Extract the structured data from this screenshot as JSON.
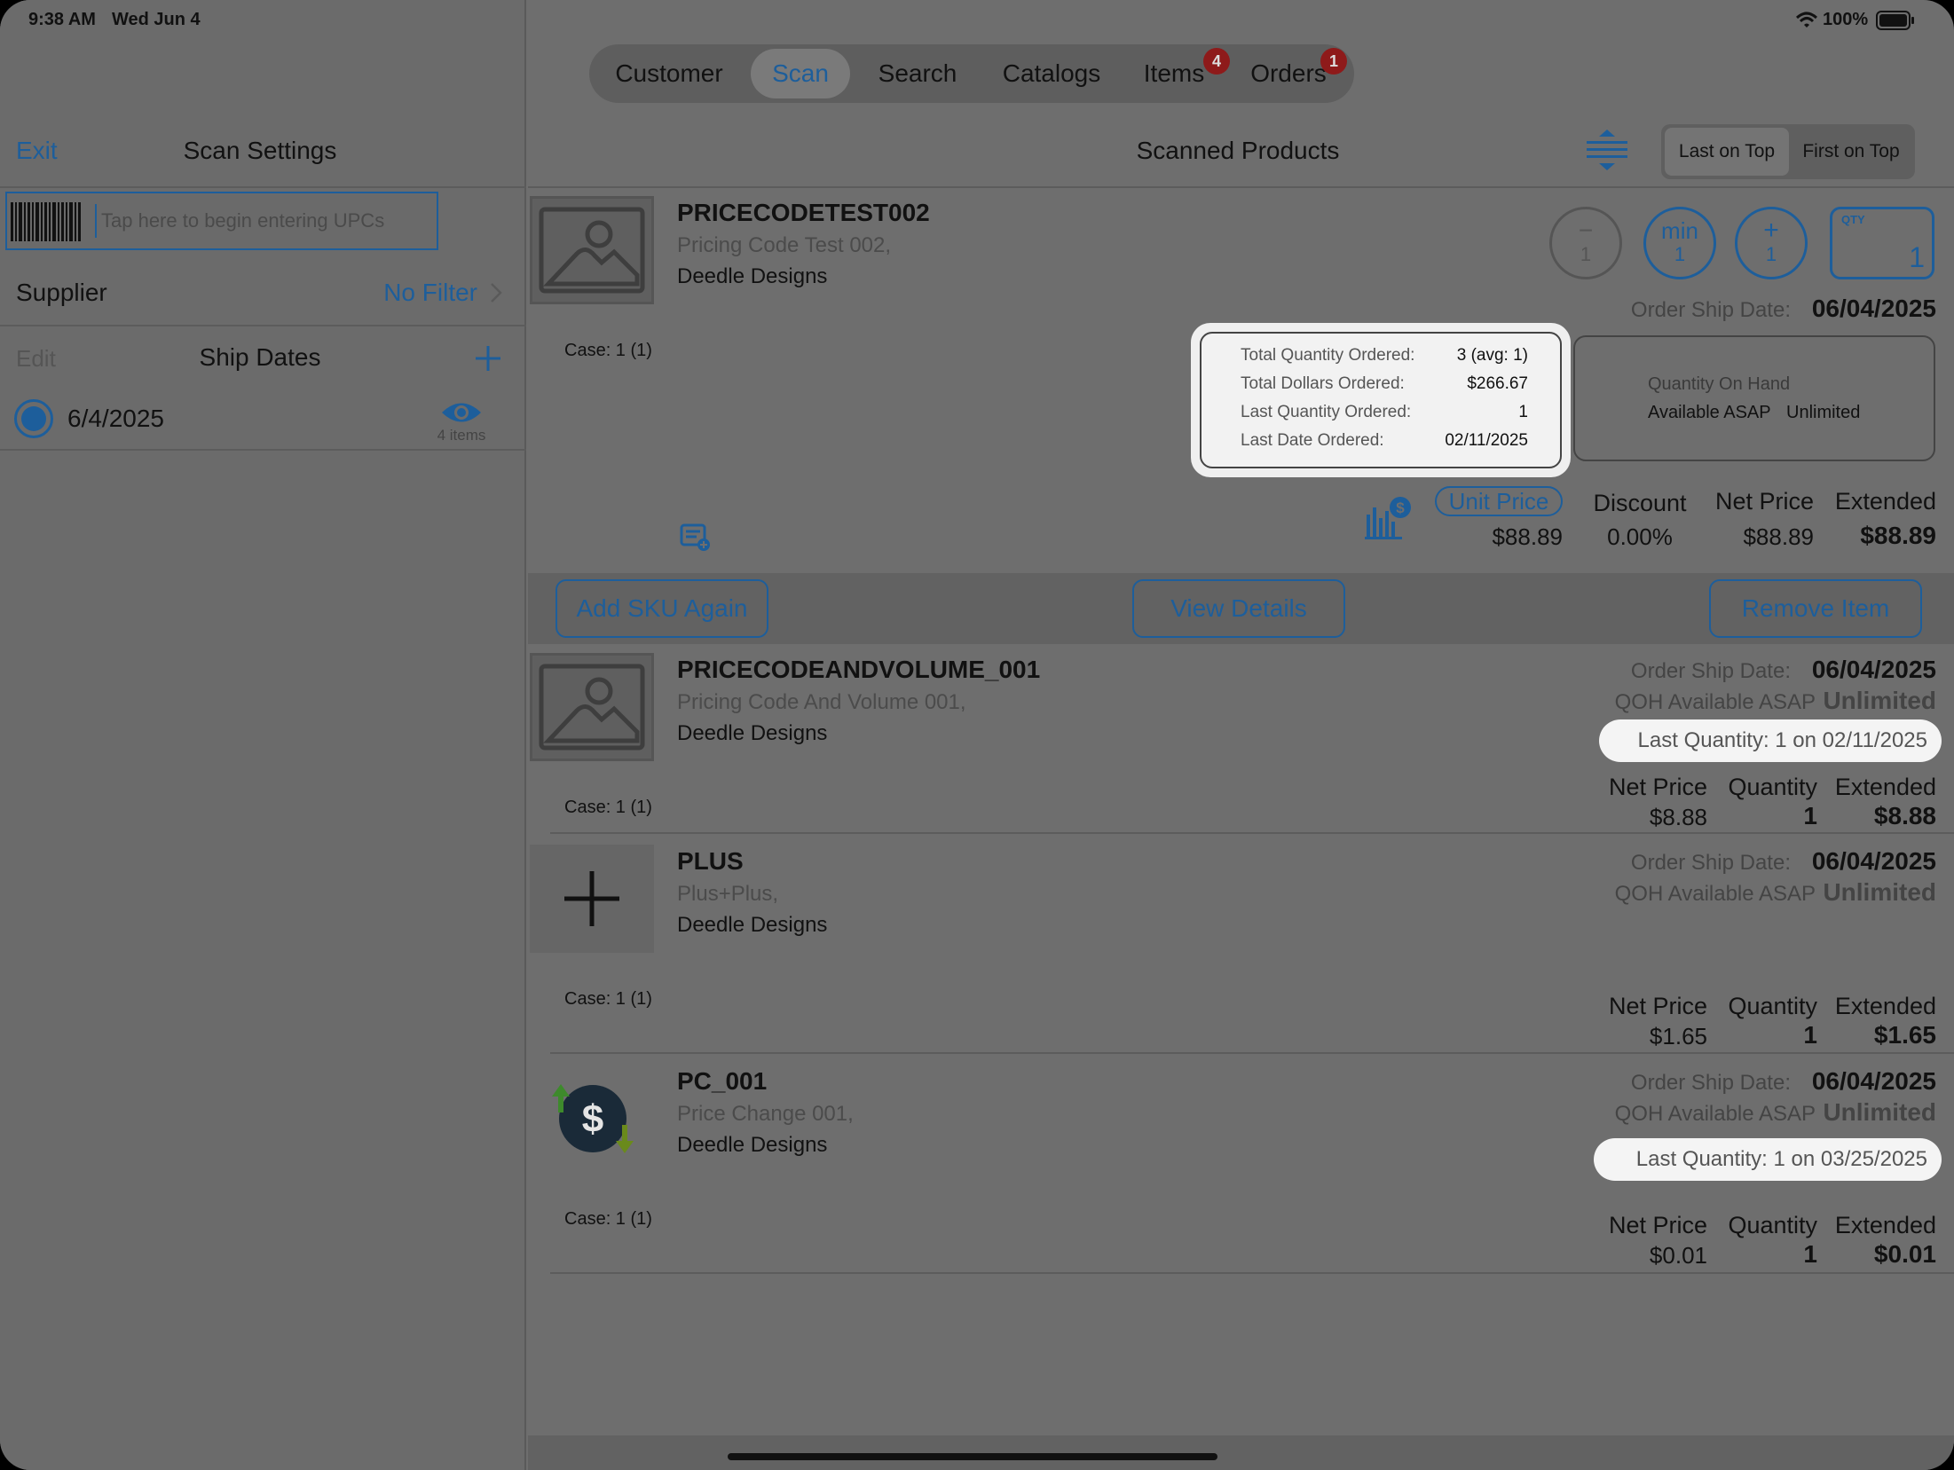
{
  "status_bar": {
    "time": "9:38 AM",
    "date": "Wed Jun 4",
    "battery": "100%"
  },
  "left_panel": {
    "exit_label": "Exit",
    "title": "Scan Settings",
    "upc_placeholder": "Tap here to begin entering UPCs",
    "supplier_label": "Supplier",
    "supplier_filter": "No Filter",
    "edit_label": "Edit",
    "ship_dates_title": "Ship Dates",
    "ship_date": "6/4/2025",
    "ship_date_count": "4 items"
  },
  "tabs": [
    {
      "label": "Customer"
    },
    {
      "label": "Scan",
      "selected": true
    },
    {
      "label": "Search"
    },
    {
      "label": "Catalogs"
    },
    {
      "label": "Items",
      "badge": "4"
    },
    {
      "label": "Orders",
      "badge": "1"
    }
  ],
  "header": {
    "title": "Scanned Products",
    "sort_last": "Last on Top",
    "sort_first": "First on Top"
  },
  "expanded_product": {
    "sku": "PRICECODETEST002",
    "description": "Pricing Code Test 002,",
    "supplier": "Deedle Designs",
    "case": "Case: 1 (1)",
    "minus_label": "−",
    "minus_value": "1",
    "min_label": "min",
    "min_value": "1",
    "plus_label": "+",
    "plus_value": "1",
    "qty_label": "QTY",
    "qty_value": "1",
    "ship_date_label": "Order Ship Date:",
    "ship_date": "06/04/2025",
    "history": {
      "total_qty_label": "Total Quantity Ordered:",
      "total_qty": "3  (avg: 1)",
      "total_dollars_label": "Total Dollars Ordered:",
      "total_dollars": "$266.67",
      "last_qty_label": "Last Quantity Ordered:",
      "last_qty": "1",
      "last_date_label": "Last Date Ordered:",
      "last_date": "02/11/2025"
    },
    "qoh_title": "Quantity On Hand",
    "qoh_available": "Available ASAP",
    "qoh_value": "Unlimited",
    "unit_price_label": "Unit Price",
    "unit_price": "$88.89",
    "discount_label": "Discount",
    "discount": "0.00%",
    "net_price_label": "Net Price",
    "net_price": "$88.89",
    "extended_label": "Extended",
    "extended": "$88.89",
    "add_sku_label": "Add SKU Again",
    "view_details_label": "View Details",
    "remove_label": "Remove Item"
  },
  "products": [
    {
      "sku": "PRICECODEANDVOLUME_001",
      "description": "Pricing Code And Volume 001,",
      "supplier": "Deedle Designs",
      "case": "Case: 1 (1)",
      "ship_date_label": "Order Ship Date:",
      "ship_date": "06/04/2025",
      "qoh_label": "QOH Available ASAP",
      "qoh_value": "Unlimited",
      "last_quantity": "Last Quantity: 1 on 02/11/2025",
      "net_price_label": "Net Price",
      "net_price": "$8.88",
      "quantity_label": "Quantity",
      "quantity": "1",
      "extended_label": "Extended",
      "extended": "$8.88"
    },
    {
      "sku": "PLUS",
      "description": "Plus+Plus,",
      "supplier": "Deedle Designs",
      "case": "Case: 1 (1)",
      "ship_date_label": "Order Ship Date:",
      "ship_date": "06/04/2025",
      "qoh_label": "QOH Available ASAP",
      "qoh_value": "Unlimited",
      "net_price_label": "Net Price",
      "net_price": "$1.65",
      "quantity_label": "Quantity",
      "quantity": "1",
      "extended_label": "Extended",
      "extended": "$1.65"
    },
    {
      "sku": "PC_001",
      "description": "Price Change 001,",
      "supplier": "Deedle Designs",
      "case": "Case: 1 (1)",
      "ship_date_label": "Order Ship Date:",
      "ship_date": "06/04/2025",
      "qoh_label": "QOH Available ASAP",
      "qoh_value": "Unlimited",
      "last_quantity": "Last Quantity: 1 on 03/25/2025",
      "net_price_label": "Net Price",
      "net_price": "$0.01",
      "quantity_label": "Quantity",
      "quantity": "1",
      "extended_label": "Extended",
      "extended": "$0.01"
    }
  ],
  "colors": {
    "accent": "#1d5e9b",
    "badge": "#8e1a1a",
    "dim_background": "#6e6e6e",
    "highlight": "#efefef"
  }
}
